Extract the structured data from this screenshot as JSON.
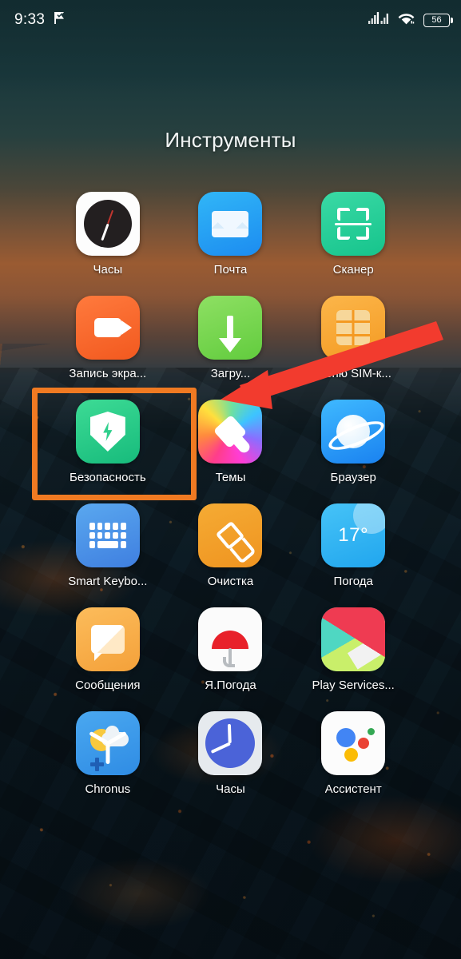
{
  "statusbar": {
    "time": "9:33",
    "flag_icon": "flag-check-icon",
    "signal_icon": "signal-bars-icon",
    "wifi_icon": "wifi-icon",
    "battery_icon": "battery-icon",
    "battery_level": "56"
  },
  "folder": {
    "title": "Инструменты"
  },
  "apps": [
    {
      "label": "Часы",
      "icon": "alarm-clock-icon"
    },
    {
      "label": "Почта",
      "icon": "mail-envelope-icon"
    },
    {
      "label": "Сканер",
      "icon": "qr-scanner-icon"
    },
    {
      "label": "Запись экра...",
      "icon": "screen-recorder-icon"
    },
    {
      "label": "Загру...",
      "icon": "downloads-arrow-icon"
    },
    {
      "label": "Меню SIM-к...",
      "icon": "sim-card-icon"
    },
    {
      "label": "Безопасность",
      "icon": "security-shield-icon"
    },
    {
      "label": "Темы",
      "icon": "themes-brush-icon"
    },
    {
      "label": "Браузер",
      "icon": "browser-planet-icon"
    },
    {
      "label": "Smart Keybo...",
      "icon": "keyboard-icon"
    },
    {
      "label": "Очистка",
      "icon": "cleaner-brush-icon"
    },
    {
      "label": "Погода",
      "icon": "weather-icon",
      "value": "17°"
    },
    {
      "label": "Сообщения",
      "icon": "messages-bubble-icon"
    },
    {
      "label": "Я.Погода",
      "icon": "yandex-weather-umbrella-icon"
    },
    {
      "label": "Play Services...",
      "icon": "play-services-icon"
    },
    {
      "label": "Chronus",
      "icon": "chronus-widget-icon"
    },
    {
      "label": "Часы",
      "icon": "clock-icon"
    },
    {
      "label": "Ассистент",
      "icon": "google-assistant-icon"
    }
  ],
  "annotations": {
    "highlight_target": "Безопасность",
    "highlight_color": "#f07a22",
    "arrow_color": "#f23b2e",
    "arrow_points_to": "Безопасность"
  }
}
